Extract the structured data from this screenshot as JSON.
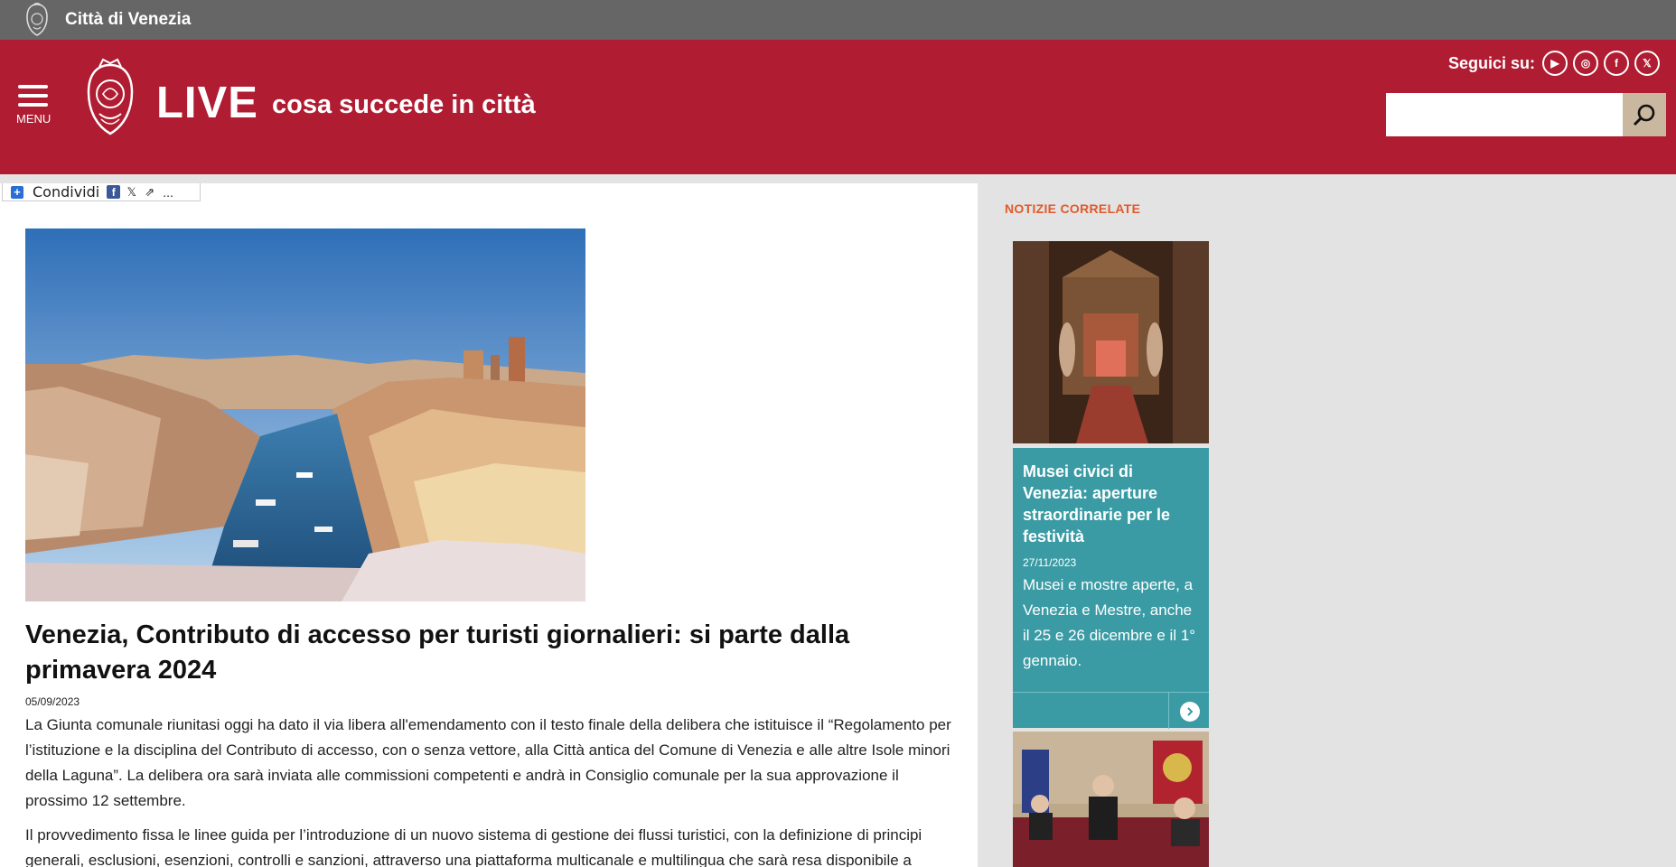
{
  "topbar": {
    "city_name": "Città di Venezia"
  },
  "header": {
    "menu_label": "MENU",
    "title": "LIVE",
    "subtitle": "cosa succede in città",
    "follow_label": "Seguici su:",
    "social": [
      {
        "icon": "youtube-icon",
        "glyph": "▶"
      },
      {
        "icon": "instagram-icon",
        "glyph": "◎"
      },
      {
        "icon": "facebook-icon",
        "glyph": "f"
      },
      {
        "icon": "x-icon",
        "glyph": "𝕏"
      }
    ],
    "search_placeholder": ""
  },
  "share": {
    "label": "Condividi",
    "more": "..."
  },
  "article": {
    "title": "Venezia, Contributo di accesso per turisti giornalieri: si parte dalla primavera 2024",
    "date": "05/09/2023",
    "paragraphs": [
      "La Giunta comunale riunitasi oggi ha dato il via libera all'emendamento con il testo finale della delibera che istituisce il “Regolamento per l’istituzione e la disciplina del Contributo di accesso, con o senza vettore, alla Città antica del Comune di Venezia e alle altre Isole minori della Laguna”. La delibera ora sarà inviata alle commissioni competenti e andrà in Consiglio comunale per la sua approvazione il prossimo 12 settembre.",
      "Il provvedimento fissa le linee guida per l’introduzione di un nuovo sistema di gestione dei flussi turistici, con la definizione di principi generali, esclusioni, esenzioni, controlli e sanzioni, attraverso una piattaforma multicanale e multilingua che sarà resa disponibile a"
    ]
  },
  "related": {
    "label": "NOTIZIE CORRELATE",
    "cards": [
      {
        "title": "Musei civici di Venezia: aperture straordinarie per le festività",
        "date": "27/11/2023",
        "description": "Musei e mostre aperte, a Venezia e Mestre, anche il 25 e 26 dicembre e il 1° gennaio."
      }
    ]
  },
  "colors": {
    "topbar": "#666666",
    "header_red": "#b01c32",
    "search_button": "#c9b79f",
    "card_teal": "#3a9ba4",
    "related_label": "#e05a2b"
  }
}
